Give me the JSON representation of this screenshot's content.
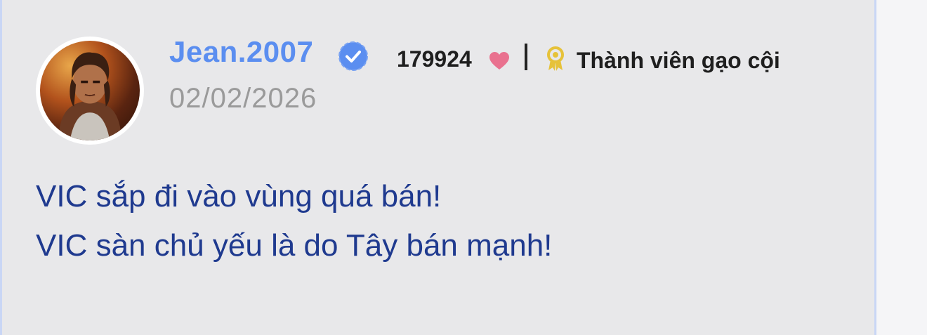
{
  "post": {
    "username": "Jean.2007",
    "date": "02/02/2026",
    "likes": "179924",
    "rank": "Thành viên gạo cội",
    "lines": [
      "VIC sắp đi vào vùng quá bán!",
      "VIC sàn chủ yếu là do Tây bán mạnh!"
    ]
  },
  "colors": {
    "username": "#5b8ef0",
    "message": "#1f3a8f",
    "heart": "#e9718f",
    "badge": "#e6c23a",
    "verified": "#5b8ef0"
  },
  "icons": {
    "verified": "verified-check-icon",
    "heart": "heart-icon",
    "badge": "award-badge-icon"
  }
}
